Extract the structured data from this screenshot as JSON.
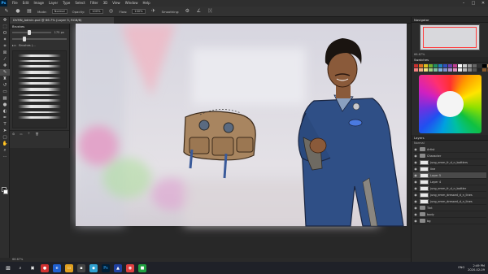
{
  "app": {
    "logo_text": "Ps"
  },
  "menubar": {
    "items": [
      "File",
      "Edit",
      "Image",
      "Layer",
      "Type",
      "Select",
      "Filter",
      "3D",
      "View",
      "Window",
      "Help"
    ]
  },
  "window_controls": {
    "minimize": "–",
    "maximize": "□",
    "close": "✕"
  },
  "options_bar": {
    "mode_label": "Mode:",
    "mode_value": "Normal",
    "opacity_label": "Opacity:",
    "opacity_value": "100%",
    "flow_label": "Flow:",
    "flow_value": "100%",
    "smoothing_label": "Smoothing:"
  },
  "document": {
    "tab_title": "DVMN_Admin.psd @ 66.7% (Layer 5, RGB/8)"
  },
  "brush_panel": {
    "title": "Brushes",
    "size_value": "175 px",
    "group_name": "Brushes (..."
  },
  "status": {
    "zoom": "66.67%"
  },
  "navigator": {
    "title": "Navigator",
    "zoom": "66.67%"
  },
  "swatches": {
    "title": "Swatches",
    "colors": [
      "#c83030",
      "#e07020",
      "#e0c020",
      "#70b030",
      "#209060",
      "#2080c0",
      "#3050c0",
      "#7040b0",
      "#c04090",
      "#ffffff",
      "#cccccc",
      "#999999",
      "#666666",
      "#333333",
      "#000000",
      "#d0a070",
      "#f08080",
      "#f0b080",
      "#f0e080",
      "#a0d080",
      "#80c0a0",
      "#80b0e0",
      "#8090d0",
      "#b090d0",
      "#e090c0",
      "#eeeeee",
      "#bbbbbb",
      "#888888",
      "#555555",
      "#222222",
      "#8b5a2b",
      "#6b4020"
    ]
  },
  "layers": {
    "title": "Layers",
    "blend_mode": "Normal",
    "rows": [
      {
        "name": "Artist",
        "kind": "folder",
        "selected": false
      },
      {
        "name": "Character",
        "kind": "folder",
        "selected": false
      },
      {
        "name": "jung_emm_fr_d_n_bottlers",
        "kind": "layer",
        "selected": false
      },
      {
        "name": "line",
        "kind": "layer",
        "selected": false
      },
      {
        "name": "Layer 5",
        "kind": "layer",
        "selected": true
      },
      {
        "name": "Layer 4",
        "kind": "layer",
        "selected": false
      },
      {
        "name": "jung_emm_fr_d_n_bottler",
        "kind": "layer",
        "selected": false
      },
      {
        "name": "jung_emm_dressed_d_n_lines",
        "kind": "layer",
        "selected": false
      },
      {
        "name": "jung_emm_dressed_d_n_lines",
        "kind": "layer",
        "selected": false
      },
      {
        "name": "Tint",
        "kind": "folder",
        "selected": false
      },
      {
        "name": "body",
        "kind": "folder",
        "selected": false
      },
      {
        "name": "bg",
        "kind": "folder",
        "selected": false
      }
    ]
  },
  "taskbar": {
    "time": "2:49 PM",
    "date": "2020-02-09",
    "lang": "ENG"
  },
  "colors": {
    "jumpsuit": "#2f4f86",
    "bag": "#a88560",
    "skin": "#8a5a3a",
    "bg_pink": "#f0c0c8"
  }
}
